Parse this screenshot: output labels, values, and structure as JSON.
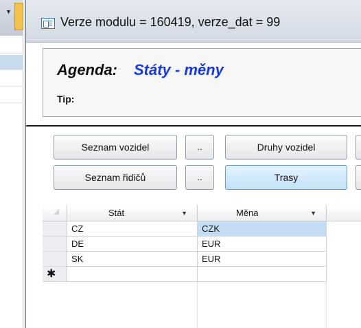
{
  "window": {
    "title": "Verze modulu = 160419, verze_dat = 99"
  },
  "header": {
    "agenda_label": "Agenda:",
    "agenda_value": "Státy - měny",
    "tip_label": "Tip:"
  },
  "toolbar": {
    "row1": [
      {
        "label": "Seznam vozidel"
      },
      {
        "label": ".."
      },
      {
        "label": "Druhy vozidel"
      }
    ],
    "row2": [
      {
        "label": "Seznam řidičů"
      },
      {
        "label": ".."
      },
      {
        "label": "Trasy"
      }
    ]
  },
  "grid": {
    "columns": [
      "Stát",
      "Měna"
    ],
    "rows": [
      {
        "stat": "CZ",
        "mena": "CZK"
      },
      {
        "stat": "DE",
        "mena": "EUR"
      },
      {
        "stat": "SK",
        "mena": "EUR"
      }
    ],
    "new_row_marker": "✱"
  },
  "colors": {
    "agenda_value": "#1437e8",
    "selected_cell": "#c5ddf4",
    "active_button": "#c3e2f7"
  }
}
